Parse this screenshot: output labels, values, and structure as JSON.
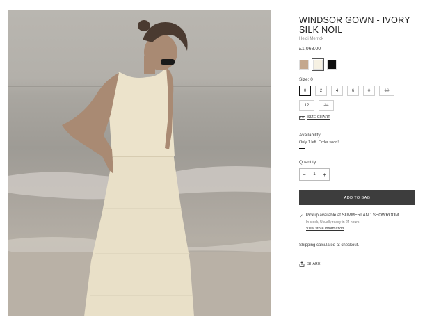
{
  "product": {
    "title": "WINDSOR GOWN - IVORY SILK NOIL",
    "brand": "Heidi Merrick",
    "price": "£1,068.00",
    "image_alt": "Model wearing ivory silk noil gown on beach"
  },
  "colors": [
    {
      "name": "tan",
      "hex": "#c4a88e",
      "selected": false
    },
    {
      "name": "ivory",
      "hex": "#f6f1e3",
      "selected": true
    },
    {
      "name": "black",
      "hex": "#0e0e0e",
      "selected": false
    }
  ],
  "sizes": {
    "label": "Size: 0",
    "options": [
      {
        "label": "0",
        "active": true,
        "available": true
      },
      {
        "label": "2",
        "active": false,
        "available": true
      },
      {
        "label": "4",
        "active": false,
        "available": true
      },
      {
        "label": "6",
        "active": false,
        "available": true
      },
      {
        "label": "8",
        "active": false,
        "available": false
      },
      {
        "label": "10",
        "active": false,
        "available": false
      },
      {
        "label": "12",
        "active": false,
        "available": true
      },
      {
        "label": "14",
        "active": false,
        "available": false
      }
    ],
    "chart_link": "SIZE CHART"
  },
  "availability": {
    "label": "Availability",
    "text": "Only 1 left. Order soon!",
    "level": 0.05
  },
  "quantity": {
    "label": "Quantity",
    "minus": "−",
    "value": "1",
    "plus": "+"
  },
  "cart": {
    "add_label": "ADD TO BAG"
  },
  "pickup": {
    "line": "Pickup available at SUMMERLAND SHOWROOM",
    "sub": "In stock, Usually ready in 24 hours",
    "link": "View store information"
  },
  "shipping": {
    "link": "Shipping",
    "text": " calculated at checkout."
  },
  "share": {
    "label": "SHARE"
  },
  "accent": "#3d3d3d"
}
